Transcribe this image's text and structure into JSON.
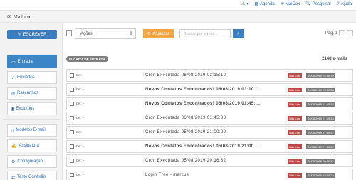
{
  "topnav": {
    "items": [
      "▾",
      "Agenda",
      "MaiCox",
      "Pesquisar",
      "Ajuda"
    ]
  },
  "window": {
    "title": "Mailbox"
  },
  "sidebar": {
    "compose_label": "ESCREVER",
    "folders": [
      {
        "label": "Entrada"
      },
      {
        "label": "Enviados"
      },
      {
        "label": "Rascunhos"
      },
      {
        "label": "Excluídos"
      }
    ],
    "tools": [
      {
        "label": "Modelos E-mail"
      },
      {
        "label": "Assinatura"
      },
      {
        "label": "Configuração"
      },
      {
        "label": "Teste Conexão"
      }
    ]
  },
  "toolbar": {
    "action_select": "Ações",
    "update_label": "Atualizar",
    "search_placeholder": "Buscar por e-mail...",
    "page_label": "Pág. 1"
  },
  "mailbox": {
    "folder_badge": "CAIXA DE ENTRADA",
    "count": "2168 e-mails",
    "messages": [
      {
        "from": "de: -",
        "subject": "Cron Executada 06/08/2019 03:15:10",
        "status": "Não Lido",
        "date": "06/08/2019 03:15:10",
        "bold": false
      },
      {
        "from": "de: -",
        "subject": "Novos Contatos Encontrados! 06/08/2019 03:10....",
        "status": "Não Lido",
        "date": "06/08/2019 03:10:08",
        "bold": true
      },
      {
        "from": "de: -",
        "subject": "Novos Contatos Encontrados! 06/08/2019 01:45:...",
        "status": "Não Lido",
        "date": "06/08/2019 01:45:33",
        "bold": true
      },
      {
        "from": "de: -",
        "subject": "Cron Executada 06/08/2019 01:45:33",
        "status": "Não Lido",
        "date": "06/08/2019 01:45:33",
        "bold": false
      },
      {
        "from": "de: -",
        "subject": "Cron Executada 05/08/2019 21:00:22",
        "status": "Não Lido",
        "date": "05/08/2019 21:00:22",
        "bold": false
      },
      {
        "from": "de: -",
        "subject": "Novos Contatos Encontrados! 05/08/2019 21:00....",
        "status": "Não Lido",
        "date": "05/08/2019 21:00:22",
        "bold": true
      },
      {
        "from": "de: -",
        "subject": "Cron Executada 05/08/2019 20:16:32",
        "status": "Não Lido",
        "date": "05/08/2019 20:16:32",
        "bold": false
      },
      {
        "from": "de: -",
        "subject": "Login Free - marcus",
        "status": "Não Lido",
        "date": "05/08/2019 19:55:19",
        "bold": false
      }
    ]
  },
  "colors": {
    "primary": "#3c7dbd",
    "warning": "#f2a540",
    "danger": "#b94a48",
    "muted": "#7a7a7a"
  }
}
